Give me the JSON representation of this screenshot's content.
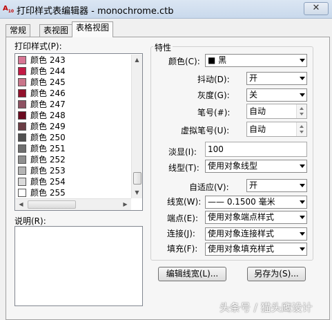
{
  "window": {
    "title": "打印样式表编辑器 - monochrome.ctb",
    "app_icon_text": "A",
    "app_icon_sub": "10",
    "close_label": "✕"
  },
  "tabs": [
    {
      "label": "常规",
      "active": false
    },
    {
      "label": "表视图",
      "active": false
    },
    {
      "label": "表格视图",
      "active": true
    }
  ],
  "styles_list": {
    "label": "打印样式(P):",
    "items": [
      {
        "label": "颜色",
        "number": "243",
        "color": "#d77594"
      },
      {
        "label": "颜色",
        "number": "244",
        "color": "#c21a45"
      },
      {
        "label": "颜色",
        "number": "245",
        "color": "#c9758a"
      },
      {
        "label": "颜色",
        "number": "246",
        "color": "#93112c"
      },
      {
        "label": "颜色",
        "number": "247",
        "color": "#8e5262"
      },
      {
        "label": "颜色",
        "number": "248",
        "color": "#6a0a1f"
      },
      {
        "label": "颜色",
        "number": "249",
        "color": "#6b3d45"
      },
      {
        "label": "颜色",
        "number": "250",
        "color": "#515151"
      },
      {
        "label": "颜色",
        "number": "251",
        "color": "#6f6f6f"
      },
      {
        "label": "颜色",
        "number": "252",
        "color": "#8f8f8f"
      },
      {
        "label": "颜色",
        "number": "253",
        "color": "#b4b4b4"
      },
      {
        "label": "颜色",
        "number": "254",
        "color": "#dadada"
      },
      {
        "label": "颜色",
        "number": "255",
        "color": "#ffffff"
      }
    ]
  },
  "description": {
    "label": "说明(R):",
    "value": ""
  },
  "properties": {
    "title": "特性",
    "color": {
      "label": "颜色(C):",
      "value": "■ 黑"
    },
    "dither": {
      "label": "抖动(D):",
      "value": "开"
    },
    "grayscale": {
      "label": "灰度(G):",
      "value": "关"
    },
    "pen_number": {
      "label": "笔号(#):",
      "value": "自动"
    },
    "virtual_pen": {
      "label": "虚拟笔号(U):",
      "value": "自动"
    },
    "screening": {
      "label": "淡显(I):",
      "value": "100"
    },
    "linetype": {
      "label": "线型(T):",
      "value": "使用对象线型"
    },
    "adaptive": {
      "label": "自适应(V):",
      "value": "开"
    },
    "lineweight": {
      "label": "线宽(W):",
      "value": "—— 0.1500 毫米"
    },
    "line_end": {
      "label": "端点(E):",
      "value": "使用对象端点样式"
    },
    "line_join": {
      "label": "连接(J):",
      "value": "使用对象连接样式"
    },
    "fill": {
      "label": "填充(F):",
      "value": "使用对象填充样式"
    }
  },
  "buttons": {
    "edit_lineweights": "编辑线宽(L)...",
    "save_as": "另存为(S)..."
  },
  "watermark": "头条号 / 猫头鹰设计"
}
